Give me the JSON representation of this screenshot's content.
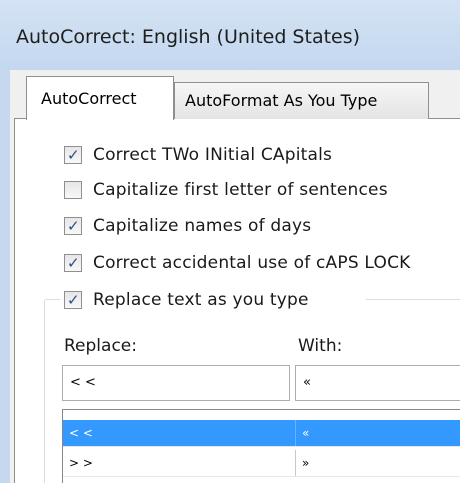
{
  "window": {
    "title": "AutoCorrect: English (United States)"
  },
  "tabs": [
    {
      "label": "AutoCorrect",
      "active": true
    },
    {
      "label": "AutoFormat As You Type",
      "active": false
    }
  ],
  "options": [
    {
      "label": "Correct TWo INitial CApitals",
      "checked": true
    },
    {
      "label": "Capitalize first letter of sentences",
      "checked": false
    },
    {
      "label": "Capitalize names of days",
      "checked": true
    },
    {
      "label": "Correct accidental use of cAPS LOCK",
      "checked": true
    },
    {
      "label": "Replace text as you type",
      "checked": true
    }
  ],
  "replace_section": {
    "replace_label": "Replace:",
    "with_label": "With:",
    "replace_value": "< <",
    "with_value": "«"
  },
  "entries": [
    {
      "replace": "< <",
      "with": "«",
      "selected": true
    },
    {
      "replace": "> >",
      "with": "»",
      "selected": false
    }
  ],
  "colors": {
    "selection": "#3399ff",
    "title_bar": "#c9dcf2",
    "checkmark": "#2c4d8a"
  }
}
